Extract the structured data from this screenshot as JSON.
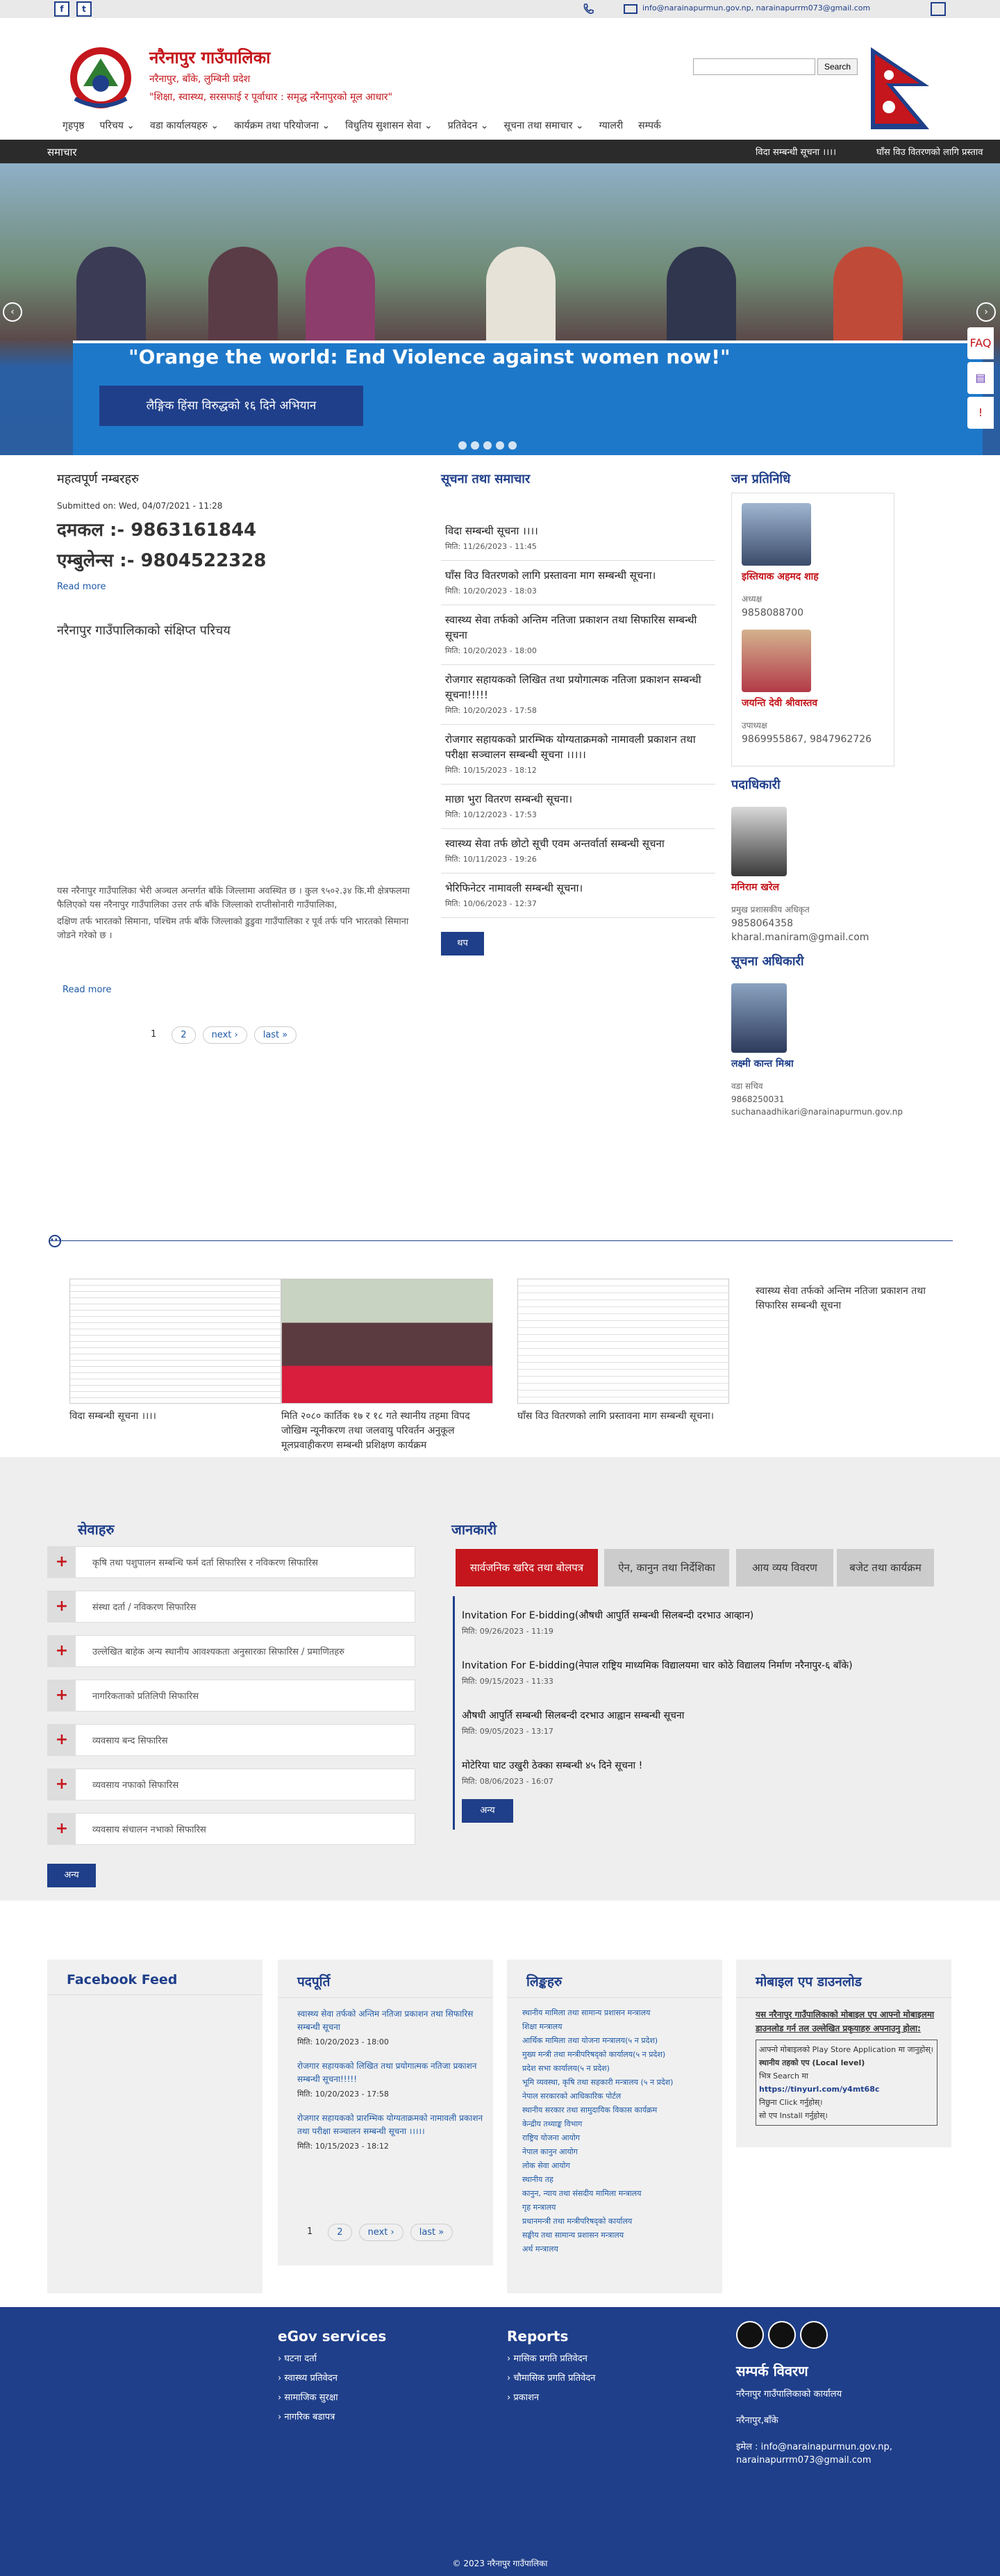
{
  "topbar": {
    "facebook": "f",
    "twitter": "t",
    "phone_icon": "phone-icon",
    "email": "info@narainapurmun.gov.np, narainapurrm073@gmail.com"
  },
  "header": {
    "org_name": "नरैनापुर गाउँपालिका",
    "address": "नरैनापुर, बाँके, लुम्बिनी प्रदेश",
    "slogan": "\"शिक्षा, स्वास्थ्य, सरसफाई र पूर्वाधार : समृद्ध नरैनापुरको मूल आधार\"",
    "search_placeholder": "",
    "search_label": "Search"
  },
  "nav": [
    "गृहपृष्ठ",
    "परिचय",
    "वडा कार्यालयहरु",
    "कार्यक्रम तथा परियोजना",
    "विधुतिय सुशासन सेवा",
    "प्रतिवेदन",
    "सूचना तथा समाचार",
    "ग्यालरी",
    "सम्पर्क"
  ],
  "newsbar": {
    "label": "समाचार",
    "ticker": [
      "विदा सम्बन्धी सूचना ।।।।",
      "घाँस विउ वितरणको लागि प्रस्ताव"
    ]
  },
  "hero": {
    "banner_text": "\"Orange the world: End Violence against women now!\"",
    "caption": "लैङ्गिक हिंसा विरुद्धको १६ दिने अभियान",
    "prev": "‹",
    "next": "›"
  },
  "important": {
    "title": "महत्वपूर्ण नम्बरहरु",
    "submitted": "Submitted on: Wed, 04/07/2021 - 11:28",
    "fire": "दमकल :- 9863161844",
    "ambulance": "एम्बुलेन्स :- 9804522328",
    "read_more": "Read more"
  },
  "intro": {
    "title": "नरैनापुर गाउँपालिकाको संक्षिप्त परिचय",
    "text1": "यस नरैनापुर गाउँपालिका भेरी अञ्चल अन्तर्गत बाँके जिल्लामा अवस्थित छ । कुल ९५०२.३४ कि.मी क्षेत्रफलमा फैलिएको यस नरैनापुर गाउँपालिका उत्तर तर्फ बाँके जिल्लाको राप्तीसोनारी गाउँपालिका,",
    "text2": "दक्षिण तर्फ भारतको सिमाना, पश्चिम तर्फ बाँके जिल्लाको डुडुवा गाउँपालिका र पूर्व तर्फ पनि भारतको सिमाना जोडने गरेको छ ।",
    "read_more": "Read more",
    "pager": [
      "1",
      "2",
      "next ›",
      "last »"
    ]
  },
  "notices": {
    "title": "सूचना तथा समाचार",
    "items": [
      {
        "t": "विदा सम्बन्धी सूचना ।।।।",
        "d": "मिति: 11/26/2023 - 11:45"
      },
      {
        "t": "घाँस विउ वितरणको लागि प्रस्तावना माग सम्बन्धी सूचना।",
        "d": "मिति: 10/20/2023 - 18:03"
      },
      {
        "t": "स्वास्थ्य सेवा तर्फको अन्तिम नतिजा प्रकाशन तथा सिफारिस सम्बन्धी सूचना",
        "d": "मिति: 10/20/2023 - 18:00"
      },
      {
        "t": "रोजगार सहायकको लिखित तथा प्रयोगात्मक नतिजा प्रकाशन सम्बन्धी सूचना!!!!!",
        "d": "मिति: 10/20/2023 - 17:58"
      },
      {
        "t": "रोजगार सहायकको प्रारम्भिक योग्यताक्रमको नामावली प्रकाशन तथा परीक्षा सञ्चालन सम्बन्धी सूचना ।।।।।",
        "d": "मिति: 10/15/2023 - 18:12"
      },
      {
        "t": "माछा भुरा वितरण सम्बन्धी सूचना।",
        "d": "मिति: 10/12/2023 - 17:53"
      },
      {
        "t": "स्वास्थ्य सेवा तर्फ छोटो सूची एवम अन्तर्वार्ता सम्बन्धी सूचना",
        "d": "मिति: 10/11/2023 - 19:26"
      },
      {
        "t": "भेरिफिनेटर नामावली सम्बन्धी सूचना।",
        "d": "मिति: 10/06/2023 - 12:37"
      }
    ],
    "more": "थप"
  },
  "reps": {
    "title": "जन प्रतिनिधि",
    "people": [
      {
        "name": "इस्तियाक अहमद शाह",
        "role": "अध्यक्ष",
        "phone": "9858088700"
      },
      {
        "name": "जयन्ति देवी श्रीवास्तव",
        "role": "उपाध्यक्ष",
        "phone": "9869955867, 9847962726"
      }
    ],
    "officer_title": "पदाधिकारी",
    "officer": {
      "name": "मनिराम खरेल",
      "role": "प्रमुख प्रशासकीय अधिकृत",
      "phone": "9858064358",
      "email": "kharal.maniram@gmail.com"
    },
    "info_officer_title": "सूचना अधिकारी",
    "info_officer": {
      "name": "लक्ष्मी कान्त मिश्रा",
      "role": "वडा सचिव",
      "phone": "9868250031",
      "email": "suchanaadhikari@narainapurmun.gov.np"
    }
  },
  "gallery": [
    {
      "cap": "विदा सम्बन्धी सूचना ।।।।"
    },
    {
      "cap": "मिति २०८० कार्तिक १७ र १८ गते स्थानीय तहमा विपद जोखिम न्यूनीकरण तथा जलवायु परिवर्तन अनुकूल मूलप्रवाहीकरण सम्बन्धी प्रशिक्षण कार्यक्रम"
    },
    {
      "cap": "घाँस विउ वितरणको लागि प्रस्तावना माग सम्बन्धी सूचना।"
    },
    {
      "cap": "स्वास्थ्य सेवा तर्फको अन्तिम नतिजा प्रकाशन तथा सिफारिस सम्बन्धी सूचना"
    }
  ],
  "services": {
    "title": "सेवाहरु",
    "items": [
      "कृषि तथा पशुपालन सम्बन्धि फर्म दर्ता सिफारिस र नविकरण सिफारिस",
      "संस्था दर्ता / नविकरण सिफारिस",
      "उल्लेखित बाहेक अन्य स्थानीय आवश्यकता अनुसारका सिफारिस / प्रमाणितहरु",
      "नागरिकताको प्रतिलिपी सिफारिस",
      "व्यवसाय बन्द सिफारिस",
      "व्यवसाय नफाको सिफारिस",
      "व्यवसाय संचालन नभाको सिफारिस"
    ],
    "more": "अन्य"
  },
  "info": {
    "title": "जानकारी",
    "tabs": [
      "सार्वजनिक खरिद तथा बोलपत्र",
      "ऐन, कानुन तथा निर्देशिका",
      "आय व्यय विवरण",
      "बजेट तथा कार्यक्रम"
    ],
    "items": [
      {
        "t": "Invitation For E-bidding(औषधी आपुर्ति सम्बन्धी सिलबन्दी दरभाउ आव्हान)",
        "d": "मिति: 09/26/2023 - 11:19"
      },
      {
        "t": "Invitation For E-bidding(नेपाल राष्ट्रिय माध्यमिक विद्यालयमा चार कोठे विद्यालय निर्माण नरैनापुर-६ बाँके)",
        "d": "मिति: 09/15/2023 - 11:33"
      },
      {
        "t": "औषधी आपुर्ति सम्बन्धी सिलबन्दी दरभाउ आह्वान सम्बन्धी सूचना",
        "d": "मिति: 09/05/2023 - 13:17"
      },
      {
        "t": "मोटेरिया घाट उखुरी ठेक्का सम्बन्धी ४५ दिने सूचना !",
        "d": "मिति: 08/06/2023 - 16:07"
      }
    ],
    "more": "अन्य"
  },
  "fb": {
    "title": "Facebook Feed"
  },
  "latest": {
    "title": "पदपूर्ति",
    "items": [
      {
        "t": "स्वास्थ्य सेवा तर्फको अन्तिम नतिजा प्रकाशन तथा सिफारिस सम्बन्धी सूचना",
        "d": "मिति: 10/20/2023 - 18:00"
      },
      {
        "t": "रोजगार सहायकको लिखित तथा प्रयोगात्मक नतिजा प्रकाशन सम्बन्धी सूचना!!!!!",
        "d": "मिति: 10/20/2023 - 17:58"
      },
      {
        "t": "रोजगार सहायकको प्रारम्भिक योग्यताक्रमको नामावली प्रकाशन तथा परीक्षा सञ्चालन सम्बन्धी सूचना ।।।।।",
        "d": "मिति: 10/15/2023 - 18:12"
      }
    ],
    "pager": [
      "1",
      "2",
      "next ›",
      "last »"
    ]
  },
  "links": {
    "title": "लिङ्कहरु",
    "items": [
      "स्थानीय मामिला तथा सामान्य प्रशासन मन्त्रालय",
      "शिक्षा मन्त्रालय",
      "आर्थिक मामिला तथा योजना मन्त्रालय(५ न प्रदेश)",
      "मुख्य मन्त्री तथा मन्त्रीपरिषद्को कार्यालय(५ न प्रदेश)",
      "प्रदेश सभा कार्यालय(५ न प्रदेश)",
      "भूमि व्यवस्था, कृषि तथा सहकारी मन्त्रालय (५ न प्रदेश)",
      "नेपाल सरकारको आधिकारिक पोर्टल",
      "स्थानीय सरकार तथा सामुदायिक विकास कार्यक्रम",
      "केन्द्रीय तथ्याङ्क विभाग",
      "राष्ट्रिय योजना आयोग",
      "नेपाल कानुन आयोग",
      "लोक सेवा आयोग",
      "स्थानीय तह",
      "कानुन, न्याय तथा संसदीय मामिला मन्त्रालय",
      "गृह मन्त्रालय",
      "प्रधानमन्त्री तथा मन्त्रीपरिषद्को कार्यालय",
      "सङ्घीय तथा सामान्य प्रशासन मन्त्रालय",
      "अर्थ मन्त्रालय"
    ]
  },
  "app": {
    "title": "मोबाइल एप डाउनलोड",
    "intro": "यस नरैनापुर गाउँपालिकाको मोबाइल एप आफ्नो मोबाइलमा डाउनलोड गर्न तल उल्लेखित प्रकृयाहरु अपनाउनु होला:",
    "steps": [
      "आफ्नो मोबाइलको Play Store Application मा जानुहोस्।",
      "स्थानीय तहको एप (Local level)",
      "भित्र Search मा",
      "https://tinyurl.com/y4mt68c",
      "निछुना Click गर्नुहोस्।",
      "सो एप Install गर्नुहोस्।"
    ]
  },
  "footer": {
    "egov_title": "eGov services",
    "egov": [
      "घटना दर्ता",
      "स्वास्थ्य प्रतिवेदन",
      "सामाजिक सुरक्षा",
      "नागरिक बडापत्र"
    ],
    "reports_title": "Reports",
    "reports": [
      "मासिक प्रगति प्रतिवेदन",
      "चौमासिक प्रगति प्रतिवेदन",
      "प्रकाशन"
    ],
    "contact_title": "सम्पर्क विवरण",
    "contact": [
      "नरैनापुर गाउँपालिकाको कार्यालय",
      "नरैनापुर,बाँके",
      "इमेल : info@narainapurmun.gov.np,",
      "narainapurrm073@gmail.com"
    ],
    "copyright": "© 2023 नरैनापुर गाउँपालिका"
  },
  "colors": {
    "primary": "#1f3f8a",
    "accent": "#c4161c",
    "newsbar": "#2b2b2b",
    "services_bg": "#eeeeee"
  }
}
